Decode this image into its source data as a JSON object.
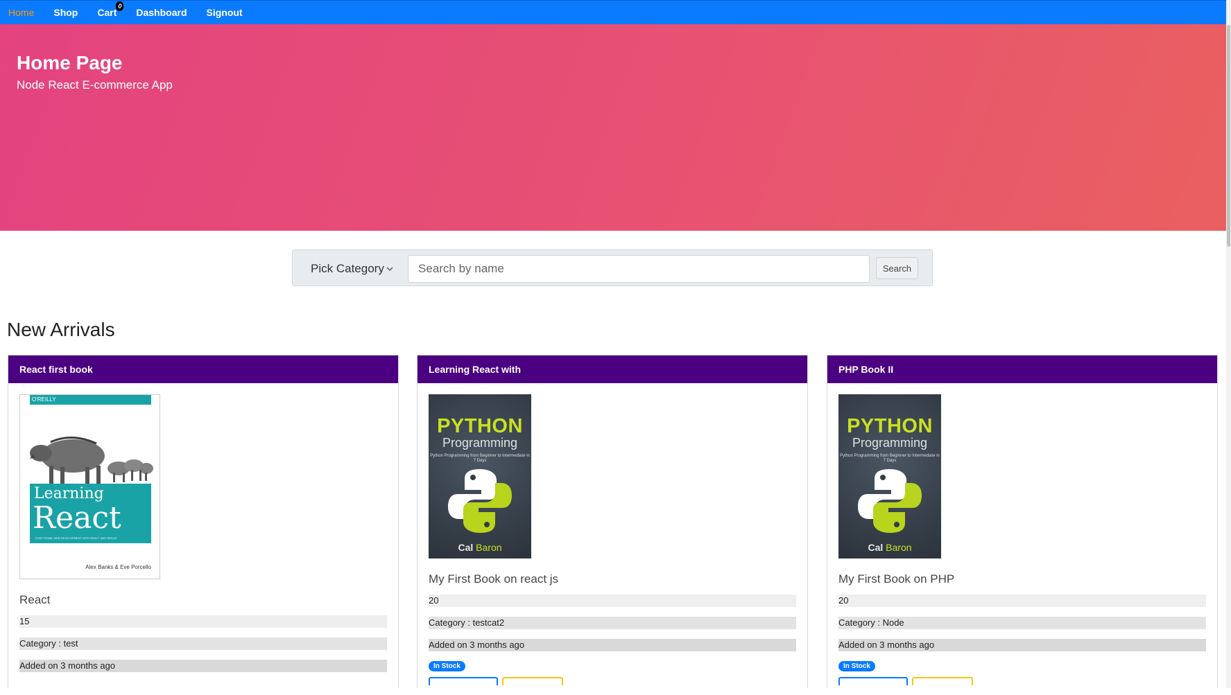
{
  "nav": {
    "items": [
      "Home",
      "Shop",
      "Cart",
      "Dashboard",
      "Signout"
    ],
    "cart_count": "0"
  },
  "hero": {
    "title": "Home Page",
    "subtitle": "Node React E-commerce App"
  },
  "search": {
    "category_label": "Pick Category",
    "placeholder": "Search by name",
    "button_label": "Search"
  },
  "section": {
    "title": "New Arrivals"
  },
  "products": [
    {
      "header": "React first book",
      "name": "React",
      "price": "15",
      "category": "Category : test",
      "added": "Added on 3 months ago",
      "cover": {
        "publisher": "O'REILLY",
        "line1": "Learning",
        "line2": "React",
        "tagline": "FUNCTIONAL WEB DEVELOPMENT WITH REACT AND REDUX",
        "authors": "Alex Banks & Eve Porcello"
      }
    },
    {
      "header": "Learning React with",
      "name": "My First Book on react js",
      "price": "20",
      "category": "Category : testcat2",
      "added": "Added on 3 months ago",
      "stock": "In Stock",
      "cover": {
        "title": "PYTHON",
        "subtitle": "Programming",
        "tagline": "Python Programming from Beginner to Intermediate in 7 Days",
        "author_first": "Cal",
        "author_last": "Baron"
      }
    },
    {
      "header": "PHP Book II",
      "name": "My First Book on PHP",
      "price": "20",
      "category": "Category : Node",
      "added": "Added on 3 months ago",
      "stock": "In Stock",
      "cover": {
        "title": "PYTHON",
        "subtitle": "Programming",
        "tagline": "Python Programming from Beginner to Intermediate in 7 Days",
        "author_first": "Cal",
        "author_last": "Baron"
      }
    }
  ]
}
